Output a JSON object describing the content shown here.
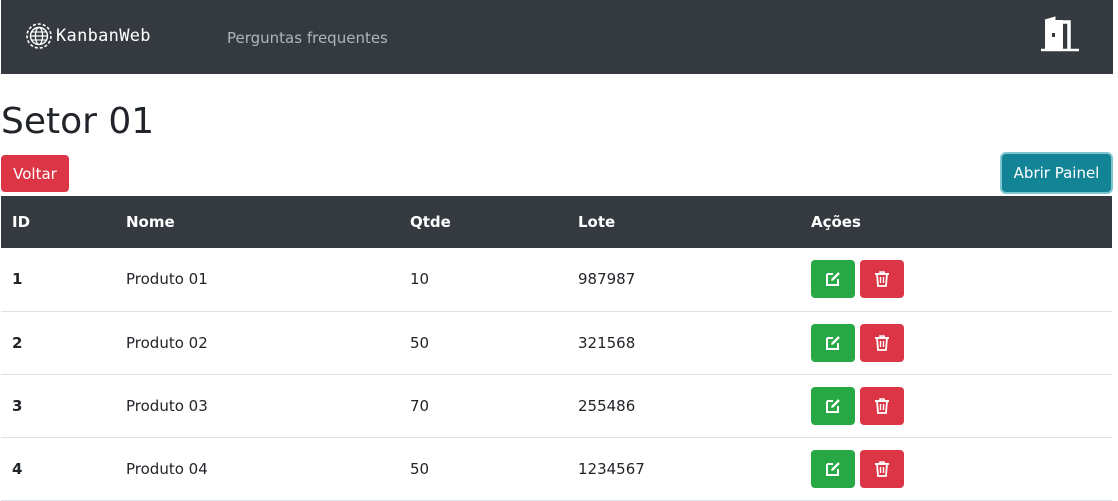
{
  "navbar": {
    "brand": "KanbanWeb",
    "link": "Perguntas frequentes",
    "exit_icon": "door-exit-icon"
  },
  "page": {
    "title": "Setor 01",
    "back_label": "Voltar",
    "open_panel_label": "Abrir Painel"
  },
  "table": {
    "headers": [
      "ID",
      "Nome",
      "Qtde",
      "Lote",
      "Ações"
    ],
    "rows": [
      {
        "id": "1",
        "nome": "Produto 01",
        "qtde": "10",
        "lote": "987987"
      },
      {
        "id": "2",
        "nome": "Produto 02",
        "qtde": "50",
        "lote": "321568"
      },
      {
        "id": "3",
        "nome": "Produto 03",
        "qtde": "70",
        "lote": "255486"
      },
      {
        "id": "4",
        "nome": "Produto 04",
        "qtde": "50",
        "lote": "1234567"
      }
    ],
    "edit_icon": "edit-icon",
    "delete_icon": "trash-icon"
  },
  "colors": {
    "navbar": "#343a40",
    "danger": "#dc3545",
    "success": "#28a745",
    "info": "#138496"
  }
}
